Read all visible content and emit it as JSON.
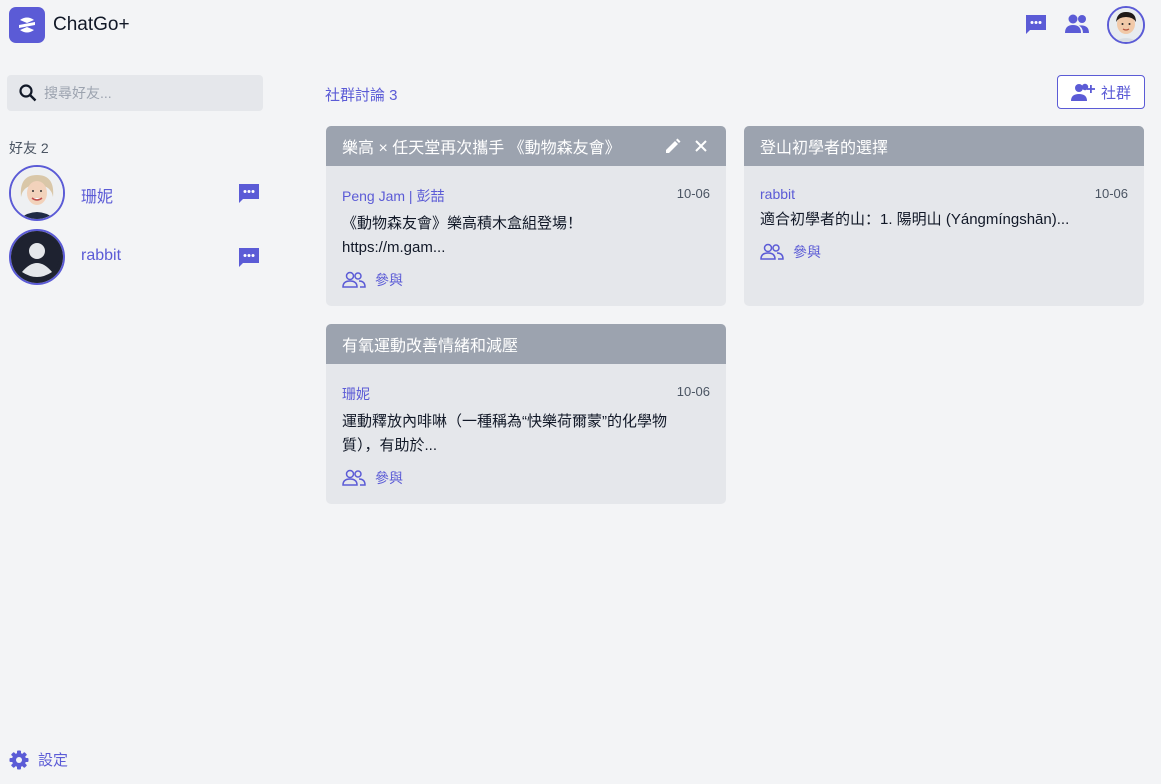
{
  "app": {
    "title": "ChatGo+"
  },
  "colors": {
    "accent": "#5b5bd6",
    "card_header": "#9ca3af",
    "card_bg": "#e5e7eb",
    "page_bg": "#f3f4f6"
  },
  "sidebar": {
    "search": {
      "placeholder": "搜尋好友..."
    },
    "friends_heading": "好友 2",
    "friends": [
      {
        "name": "珊妮",
        "avatar": "avatar-photo"
      },
      {
        "name": "rabbit",
        "avatar": "default-avatar-icon"
      }
    ],
    "settings_label": "設定"
  },
  "main": {
    "section_title": "社群討論 3",
    "add_community_label": "社群",
    "discussions": [
      {
        "title": "樂高 × 任天堂再次攜手 《動物森友會》",
        "author": "Peng Jam | 彭喆",
        "date": "10-06",
        "excerpt": "《動物森友會》樂高積木盒組登場！https://m.gam...",
        "join_label": "參與",
        "editable": true
      },
      {
        "title": "登山初學者的選擇",
        "author": "rabbit",
        "date": "10-06",
        "excerpt": "適合初學者的山：1. 陽明山 (Yángmíngshān)...",
        "join_label": "參與",
        "editable": false
      },
      {
        "title": "有氧運動改善情緒和減壓",
        "author": "珊妮",
        "date": "10-06",
        "excerpt": "運動釋放內啡啉（一種稱為“快樂荷爾蒙”的化學物質），有助於...",
        "join_label": "參與",
        "editable": false
      }
    ]
  }
}
